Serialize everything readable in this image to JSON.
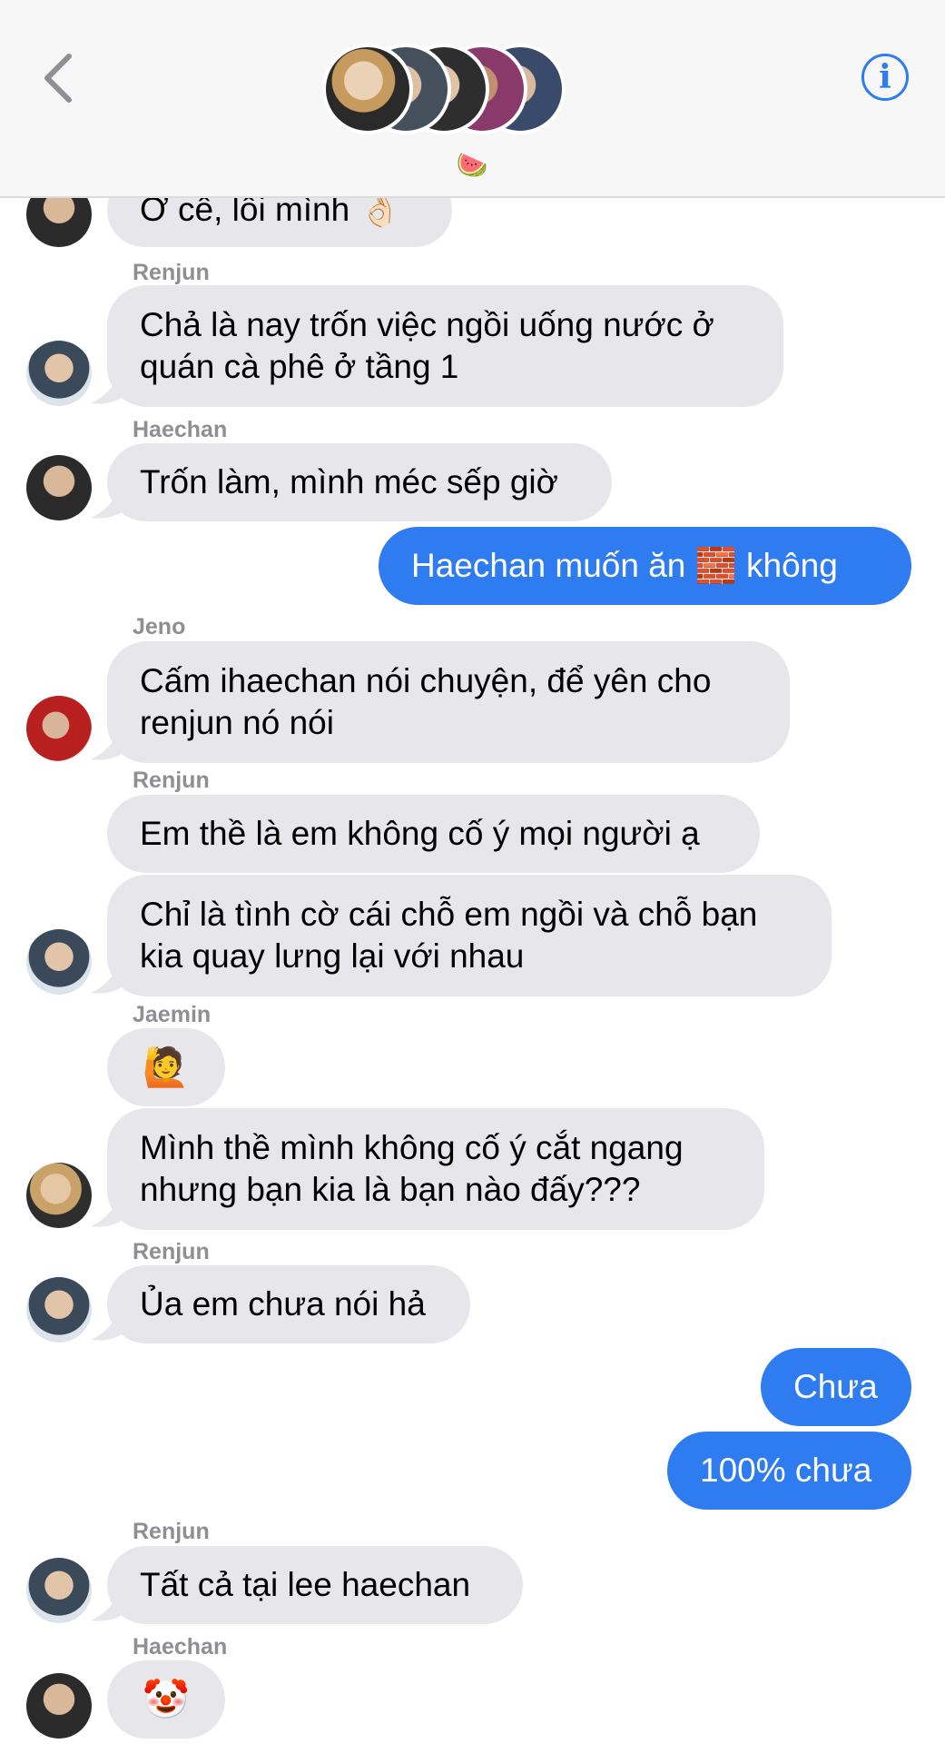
{
  "header": {
    "group_emoji": "🍉",
    "info_label": "i"
  },
  "colors": {
    "outgoing": "#2f7bf0",
    "incoming": "#e6e6eb",
    "sender_name": "#8e8e93",
    "header_bg": "#f7f7f7"
  },
  "messages": [
    {
      "text": "Ờ cê, lỗi mình 👌🏻"
    },
    {
      "sender": "Renjun",
      "text": "Chả là nay trốn việc ngồi uống nước ở\nquán cà phê ở tầng 1"
    },
    {
      "sender": "Haechan",
      "text": "Trốn làm, mình méc sếp giờ"
    },
    {
      "text": "Haechan muốn ăn 🧱 không"
    },
    {
      "sender": "Jeno",
      "text": "Cấm ihaechan nói chuyện, để yên cho\nrenjun nó nói"
    },
    {
      "sender": "Renjun",
      "text": "Em thề là em không cố ý mọi người ạ"
    },
    {
      "text": "Chỉ là tình cờ cái chỗ em ngồi và chỗ bạn\nkia quay lưng lại với nhau"
    },
    {
      "sender": "Jaemin",
      "text": "🙋"
    },
    {
      "text": "Mình thề mình không cố ý cắt ngang\nnhưng bạn kia là bạn nào đấy???"
    },
    {
      "sender": "Renjun",
      "text": "Ủa em chưa nói hả"
    },
    {
      "text": "Chưa"
    },
    {
      "text": "100% chưa"
    },
    {
      "sender": "Renjun",
      "text": "Tất cả tại lee haechan"
    },
    {
      "sender": "Haechan",
      "text": "🤡"
    }
  ]
}
